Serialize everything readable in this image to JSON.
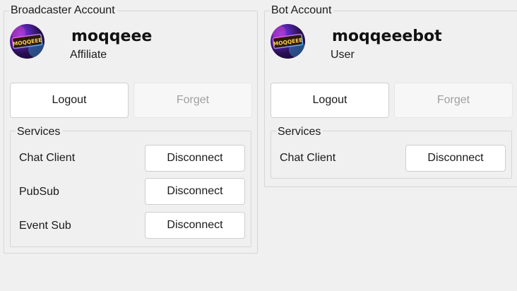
{
  "broadcaster": {
    "group_title": "Broadcaster Account",
    "username": "moqqeee",
    "role": "Affiliate",
    "avatar_text": "MOQQEEE",
    "logout_label": "Logout",
    "forget_label": "Forget",
    "services_title": "Services",
    "services": [
      {
        "name": "Chat Client",
        "action": "Disconnect"
      },
      {
        "name": "PubSub",
        "action": "Disconnect"
      },
      {
        "name": "Event Sub",
        "action": "Disconnect"
      }
    ]
  },
  "bot": {
    "group_title": "Bot Account",
    "username": "moqqeeebot",
    "role": "User",
    "avatar_text": "MOQQEEE",
    "logout_label": "Logout",
    "forget_label": "Forget",
    "services_title": "Services",
    "services": [
      {
        "name": "Chat Client",
        "action": "Disconnect"
      }
    ]
  },
  "colors": {
    "background": "#f0f0f0",
    "button": "#ffffff",
    "button_border": "#cfcfcf",
    "disabled_text": "#a0a0a0",
    "groupbox_border": "#d6d6d6"
  }
}
